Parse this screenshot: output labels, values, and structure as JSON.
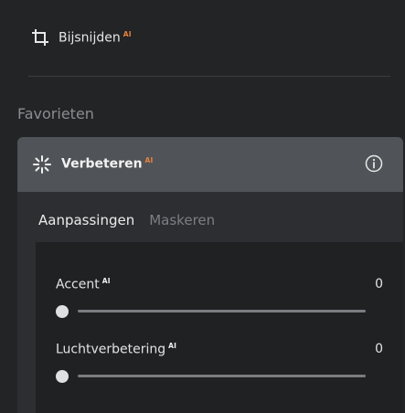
{
  "crop": {
    "label": "Bijsnijden",
    "badge": "AI"
  },
  "favorites": {
    "title": "Favorieten"
  },
  "enhance": {
    "title": "Verbeteren",
    "badge": "AI"
  },
  "tabs": [
    {
      "label": "Aanpassingen",
      "active": true
    },
    {
      "label": "Maskeren",
      "active": false
    }
  ],
  "sliders": [
    {
      "label": "Accent",
      "badge": "AI",
      "value": "0"
    },
    {
      "label": "Luchtverbetering",
      "badge": "AI",
      "value": "0"
    }
  ],
  "colors": {
    "ai_badge_accent": "#e8823c"
  },
  "icons": [
    "crop-icon",
    "sparkle-icon",
    "info-icon"
  ]
}
